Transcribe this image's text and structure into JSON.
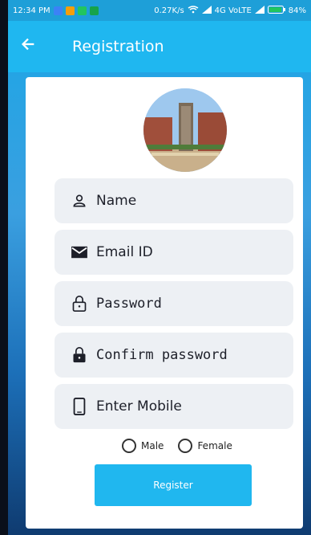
{
  "status_bar": {
    "time": "12:34 PM",
    "speed": "0.27K/s",
    "network": "4G VoLTE",
    "battery": "84%"
  },
  "app_bar": {
    "title": "Registration"
  },
  "form": {
    "name_placeholder": "Name",
    "email_placeholder": "Email ID",
    "password_placeholder": "Password",
    "confirm_placeholder": "Confirm password",
    "mobile_placeholder": "Enter Mobile"
  },
  "gender": {
    "male": "Male",
    "female": "Female"
  },
  "buttons": {
    "register": "Register"
  },
  "colors": {
    "primary": "#1fb7f0",
    "status_bar": "#1e9fd8",
    "field_bg": "#edf0f4",
    "text": "#1d1f29"
  },
  "icons": {
    "back": "arrow-left-icon",
    "name": "user-icon",
    "email": "envelope-icon",
    "password": "lock-outline-icon",
    "confirm": "lock-filled-icon",
    "mobile": "phone-icon"
  }
}
